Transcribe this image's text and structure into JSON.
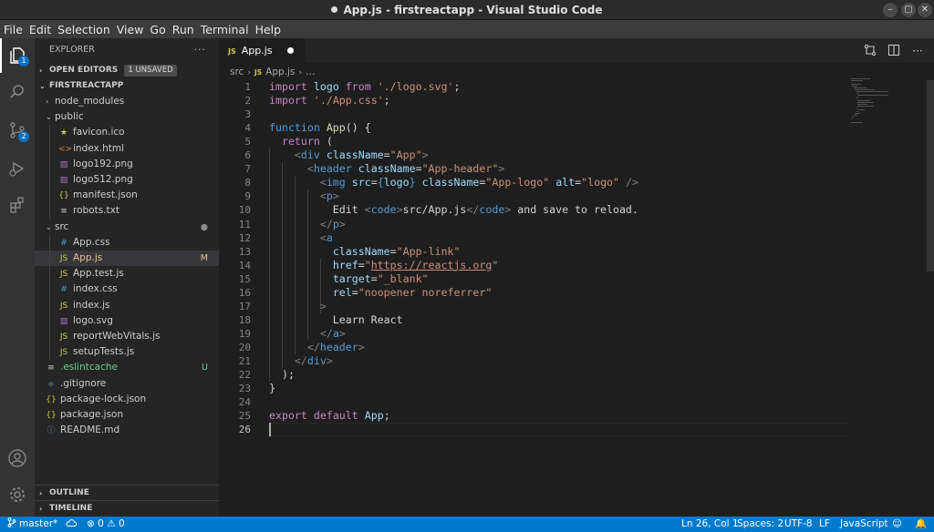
{
  "window": {
    "title": "App.js - firstreactapp - Visual Studio Code"
  },
  "menu": [
    "File",
    "Edit",
    "Selection",
    "View",
    "Go",
    "Run",
    "Terminal",
    "Help"
  ],
  "activity": {
    "explorer_badge": "1",
    "scm_badge": "2"
  },
  "sidebar": {
    "header": "EXPLORER",
    "more": "···",
    "open_editors": {
      "label": "OPEN EDITORS",
      "badge": "1 UNSAVED"
    },
    "project": "FIRSTREACTAPP",
    "files": [
      {
        "name": "node_modules",
        "kind": "folder-closed",
        "indent": 1,
        "status": ""
      },
      {
        "name": "public",
        "kind": "folder-open",
        "indent": 1,
        "status": ""
      },
      {
        "name": "favicon.ico",
        "kind": "star",
        "indent": 2,
        "status": ""
      },
      {
        "name": "index.html",
        "kind": "html",
        "indent": 2,
        "status": ""
      },
      {
        "name": "logo192.png",
        "kind": "image",
        "indent": 2,
        "status": ""
      },
      {
        "name": "logo512.png",
        "kind": "image",
        "indent": 2,
        "status": ""
      },
      {
        "name": "manifest.json",
        "kind": "json",
        "indent": 2,
        "status": ""
      },
      {
        "name": "robots.txt",
        "kind": "text",
        "indent": 2,
        "status": ""
      },
      {
        "name": "src",
        "kind": "folder-open",
        "indent": 1,
        "status": "●"
      },
      {
        "name": "App.css",
        "kind": "css",
        "indent": 2,
        "status": ""
      },
      {
        "name": "App.js",
        "kind": "js",
        "indent": 2,
        "status": "M",
        "selected": true
      },
      {
        "name": "App.test.js",
        "kind": "js",
        "indent": 2,
        "status": ""
      },
      {
        "name": "index.css",
        "kind": "css",
        "indent": 2,
        "status": ""
      },
      {
        "name": "index.js",
        "kind": "js",
        "indent": 2,
        "status": ""
      },
      {
        "name": "logo.svg",
        "kind": "svg",
        "indent": 2,
        "status": ""
      },
      {
        "name": "reportWebVitals.js",
        "kind": "js",
        "indent": 2,
        "status": ""
      },
      {
        "name": "setupTests.js",
        "kind": "js",
        "indent": 2,
        "status": ""
      },
      {
        "name": ".eslintcache",
        "kind": "text",
        "indent": 1,
        "status": "U"
      },
      {
        "name": ".gitignore",
        "kind": "git",
        "indent": 1,
        "status": ""
      },
      {
        "name": "package-lock.json",
        "kind": "json",
        "indent": 1,
        "status": ""
      },
      {
        "name": "package.json",
        "kind": "json",
        "indent": 1,
        "status": ""
      },
      {
        "name": "README.md",
        "kind": "info",
        "indent": 1,
        "status": ""
      }
    ],
    "outline": "OUTLINE",
    "timeline": "TIMELINE"
  },
  "icons": {
    "folder-closed": "›",
    "folder-open": "⌄",
    "star": "★",
    "html": "<>",
    "image": "▨",
    "json": "{}",
    "text": "≡",
    "css": "#",
    "js": "JS",
    "svg": "▨",
    "git": "◆",
    "info": "ⓘ"
  },
  "icon_colors": {
    "star": "#cbcb41",
    "html": "#e37933",
    "image": "#a074c4",
    "json": "#cbcb41",
    "text": "#cccccc",
    "css": "#519aba",
    "js": "#cbcb41",
    "svg": "#a074c4",
    "git": "#41535b",
    "info": "#519aba",
    "folder-closed": "#c5c5c5",
    "folder-open": "#c5c5c5"
  },
  "status_colors": {
    "M": "#e2c08d",
    "U": "#73c991",
    "●": "#8a8a8a"
  },
  "tab": {
    "label": "App.js",
    "ext": "JS"
  },
  "breadcrumb": {
    "folder": "src",
    "file": "App.js",
    "ellipsis": "…"
  },
  "code": [
    [
      [
        "kw",
        "import"
      ],
      [
        "txt",
        " "
      ],
      [
        "var",
        "logo"
      ],
      [
        "txt",
        " "
      ],
      [
        "kw",
        "from"
      ],
      [
        "txt",
        " "
      ],
      [
        "str",
        "'./logo.svg'"
      ],
      [
        "txt",
        ";"
      ]
    ],
    [
      [
        "kw",
        "import"
      ],
      [
        "txt",
        " "
      ],
      [
        "str",
        "'./App.css'"
      ],
      [
        "txt",
        ";"
      ]
    ],
    [],
    [
      [
        "bl",
        "function"
      ],
      [
        "txt",
        " "
      ],
      [
        "fn",
        "App"
      ],
      [
        "txt",
        "() {"
      ]
    ],
    [
      [
        "txt",
        "  "
      ],
      [
        "kw",
        "return"
      ],
      [
        "txt",
        " ("
      ]
    ],
    [
      [
        "txt",
        "    "
      ],
      [
        "tagc",
        "<"
      ],
      [
        "bl",
        "div"
      ],
      [
        "txt",
        " "
      ],
      [
        "attr",
        "className"
      ],
      [
        "txt",
        "="
      ],
      [
        "str",
        "\"App\""
      ],
      [
        "tagc",
        ">"
      ]
    ],
    [
      [
        "txt",
        "      "
      ],
      [
        "tagc",
        "<"
      ],
      [
        "bl",
        "header"
      ],
      [
        "txt",
        " "
      ],
      [
        "attr",
        "className"
      ],
      [
        "txt",
        "="
      ],
      [
        "str",
        "\"App-header\""
      ],
      [
        "tagc",
        ">"
      ]
    ],
    [
      [
        "txt",
        "        "
      ],
      [
        "tagc",
        "<"
      ],
      [
        "bl",
        "img"
      ],
      [
        "txt",
        " "
      ],
      [
        "attr",
        "src"
      ],
      [
        "txt",
        "="
      ],
      [
        "bl",
        "{"
      ],
      [
        "var",
        "logo"
      ],
      [
        "bl",
        "}"
      ],
      [
        "txt",
        " "
      ],
      [
        "attr",
        "className"
      ],
      [
        "txt",
        "="
      ],
      [
        "str",
        "\"App-logo\""
      ],
      [
        "txt",
        " "
      ],
      [
        "attr",
        "alt"
      ],
      [
        "txt",
        "="
      ],
      [
        "str",
        "\"logo\""
      ],
      [
        "txt",
        " "
      ],
      [
        "tagc",
        "/>"
      ]
    ],
    [
      [
        "txt",
        "        "
      ],
      [
        "tagc",
        "<"
      ],
      [
        "bl",
        "p"
      ],
      [
        "tagc",
        ">"
      ]
    ],
    [
      [
        "txt",
        "          Edit "
      ],
      [
        "tagc",
        "<"
      ],
      [
        "bl",
        "code"
      ],
      [
        "tagc",
        ">"
      ],
      [
        "txt",
        "src/App.js"
      ],
      [
        "tagc",
        "</"
      ],
      [
        "bl",
        "code"
      ],
      [
        "tagc",
        ">"
      ],
      [
        "txt",
        " and save to reload."
      ]
    ],
    [
      [
        "txt",
        "        "
      ],
      [
        "tagc",
        "</"
      ],
      [
        "bl",
        "p"
      ],
      [
        "tagc",
        ">"
      ]
    ],
    [
      [
        "txt",
        "        "
      ],
      [
        "tagc",
        "<"
      ],
      [
        "bl",
        "a"
      ]
    ],
    [
      [
        "txt",
        "          "
      ],
      [
        "attr",
        "className"
      ],
      [
        "txt",
        "="
      ],
      [
        "str",
        "\"App-link\""
      ]
    ],
    [
      [
        "txt",
        "          "
      ],
      [
        "attr",
        "href"
      ],
      [
        "txt",
        "="
      ],
      [
        "str",
        "\""
      ],
      [
        "strul",
        "https://reactjs.org"
      ],
      [
        "str",
        "\""
      ]
    ],
    [
      [
        "txt",
        "          "
      ],
      [
        "attr",
        "target"
      ],
      [
        "txt",
        "="
      ],
      [
        "str",
        "\"_blank\""
      ]
    ],
    [
      [
        "txt",
        "          "
      ],
      [
        "attr",
        "rel"
      ],
      [
        "txt",
        "="
      ],
      [
        "str",
        "\"noopener noreferrer\""
      ]
    ],
    [
      [
        "txt",
        "        "
      ],
      [
        "tagc",
        ">"
      ]
    ],
    [
      [
        "txt",
        "          Learn React"
      ]
    ],
    [
      [
        "txt",
        "        "
      ],
      [
        "tagc",
        "</"
      ],
      [
        "bl",
        "a"
      ],
      [
        "tagc",
        ">"
      ]
    ],
    [
      [
        "txt",
        "      "
      ],
      [
        "tagc",
        "</"
      ],
      [
        "bl",
        "header"
      ],
      [
        "tagc",
        ">"
      ]
    ],
    [
      [
        "txt",
        "    "
      ],
      [
        "tagc",
        "</"
      ],
      [
        "bl",
        "div"
      ],
      [
        "tagc",
        ">"
      ]
    ],
    [
      [
        "txt",
        "  );"
      ]
    ],
    [
      [
        "txt",
        "}"
      ]
    ],
    [],
    [
      [
        "kw",
        "export"
      ],
      [
        "txt",
        " "
      ],
      [
        "kw",
        "default"
      ],
      [
        "txt",
        " "
      ],
      [
        "var",
        "App"
      ],
      [
        "txt",
        ";"
      ]
    ],
    []
  ],
  "cursor_line": 26,
  "statusbar": {
    "branch": "master*",
    "errors": "0",
    "warnings": "0",
    "position": "Ln 26, Col 1",
    "spaces": "Spaces: 2",
    "encoding": "UTF-8",
    "eol": "LF",
    "language": "JavaScript"
  }
}
